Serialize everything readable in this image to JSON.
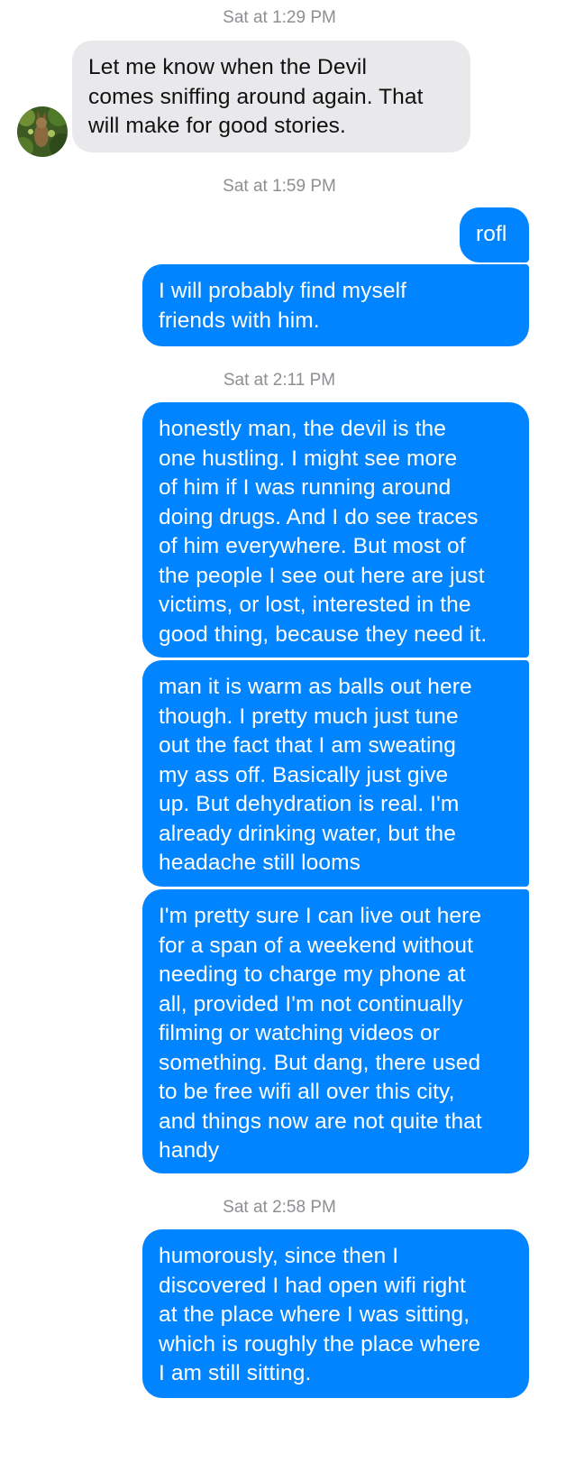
{
  "thread": {
    "timestamps": [
      "Sat at 1:29 PM",
      "Sat at 1:59 PM",
      "Sat at 2:11 PM",
      "Sat at 2:58 PM"
    ],
    "messages": [
      {
        "sender": "contact",
        "text": "Let me know when the Devil\ncomes sniffing around again. That\nwill make for good stories."
      },
      {
        "sender": "me",
        "text": "rofl"
      },
      {
        "sender": "me",
        "text": "I will probably find myself\nfriends with him."
      },
      {
        "sender": "me",
        "text": "honestly man, the devil is the\none hustling. I might see more\nof him if I was running around\ndoing drugs. And I do see traces\nof him everywhere. But most of\nthe people I see out here are just\nvictims, or lost, interested in the\ngood thing, because they need it."
      },
      {
        "sender": "me",
        "text": "man it is warm as balls out here\nthough. I pretty much just tune\nout the fact that I am sweating\nmy ass off. Basically just give\nup. But dehydration is real. I'm\nalready drinking water, but the\nheadache still looms"
      },
      {
        "sender": "me",
        "text": "I'm pretty sure I can live out here\nfor a span of a weekend without\nneeding to charge my phone at\nall, provided I'm not continually\nfilming or watching videos or\nsomething. But dang, there used\nto be free wifi all over this city,\nand things now are not quite that\nhandy"
      },
      {
        "sender": "me",
        "text": "humorously, since then I\ndiscovered I had open wifi right\nat the place where I was sitting,\nwhich is roughly the place where\nI am still sitting."
      }
    ]
  },
  "colors": {
    "outgoing_bubble": "#0084ff",
    "incoming_bubble": "#e9e9eb",
    "timestamp_text": "#8e8e93"
  },
  "icons": {
    "contact_avatar": "contact-avatar-photo"
  }
}
